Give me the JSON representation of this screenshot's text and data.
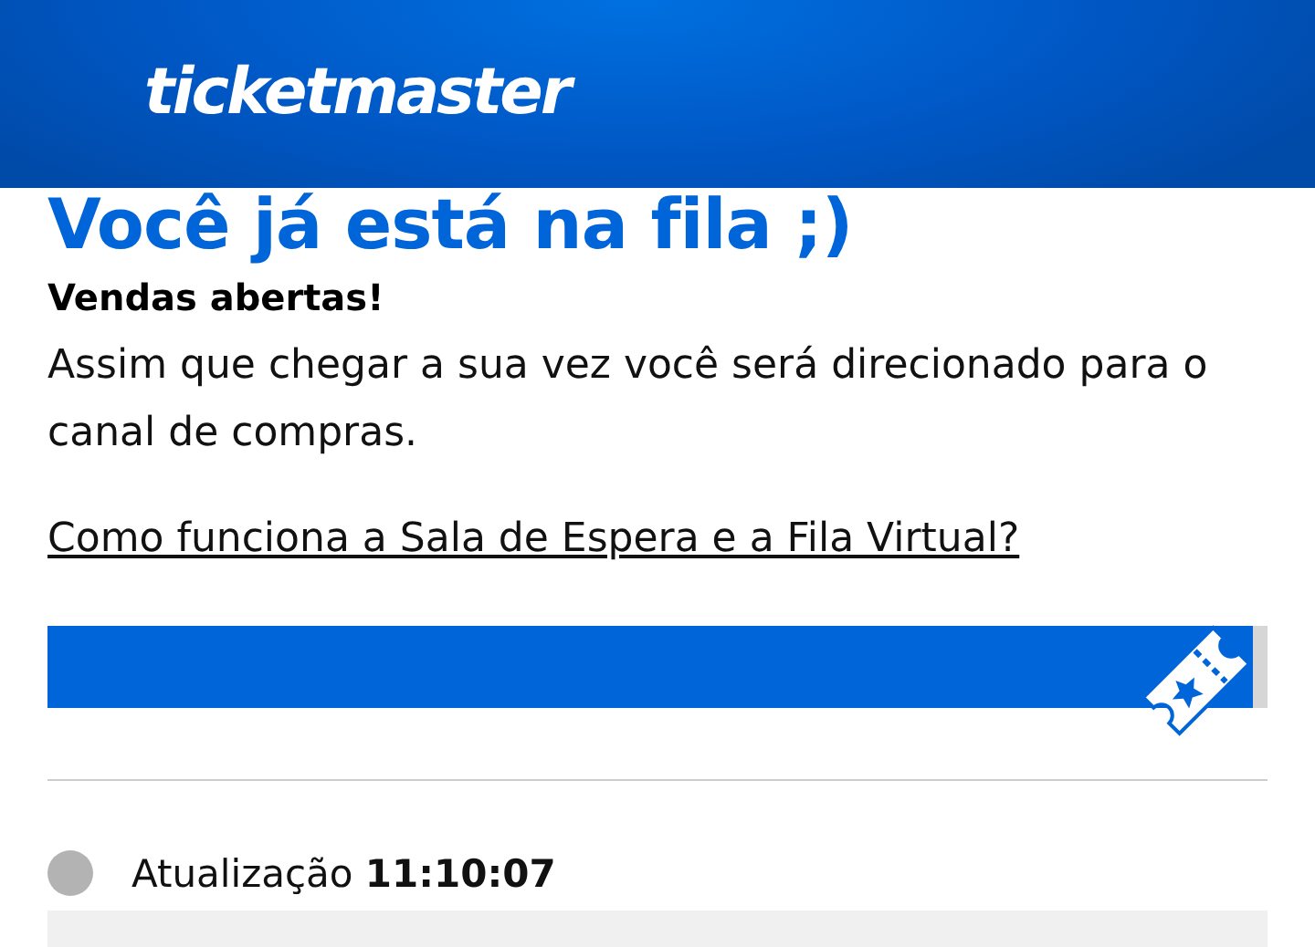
{
  "header": {
    "logo": "ticketmaster"
  },
  "title": "Você já está na fila ;)",
  "subtitle": "Vendas abertas!",
  "message": "Assim que chegar a sua vez você será direcionado para o canal de compras.",
  "help_link": "Como funciona a Sala de Espera e a Fila Virtual?",
  "progress": {
    "level": 0.988
  },
  "status": {
    "color": "#b3b3b3",
    "text": "Atualização **11:10:07**"
  }
}
